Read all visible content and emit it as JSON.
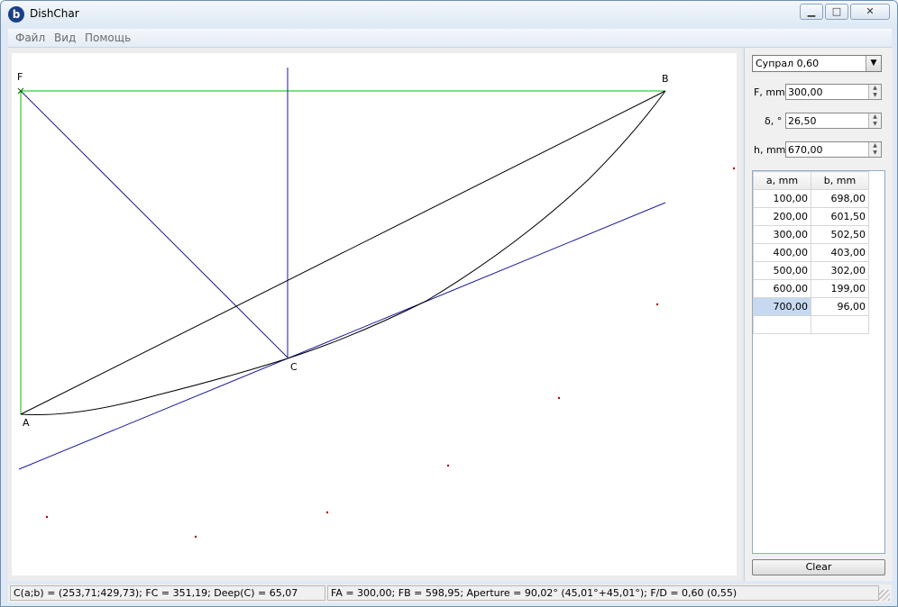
{
  "window": {
    "title": "DishChar",
    "icon": "b"
  },
  "menu": [
    "Файл",
    "Вид",
    "Помощь"
  ],
  "points": {
    "F": "F",
    "B": "B",
    "A": "A",
    "C": "C"
  },
  "controls": {
    "material": "Супрал 0,60",
    "F_label": "F, mm",
    "F_value": "300,00",
    "delta_label": "δ, °",
    "delta_value": "26,50",
    "h_label": "h, mm",
    "h_value": "670,00"
  },
  "table": {
    "headers": [
      "a, mm",
      "b, mm"
    ],
    "rows": [
      [
        "100,00",
        "698,00"
      ],
      [
        "200,00",
        "601,50"
      ],
      [
        "300,00",
        "502,50"
      ],
      [
        "400,00",
        "403,00"
      ],
      [
        "500,00",
        "302,00"
      ],
      [
        "600,00",
        "199,00"
      ],
      [
        "700,00",
        "96,00"
      ]
    ]
  },
  "clear_label": "Clear",
  "status": {
    "left": "C(a;b) = (253,71;429,73); FC = 351,19; Deep(C) = 65,07",
    "right": "FA = 300,00; FB = 598,95; Aperture = 90,02° (45,01°+45,01°); F/D = 0,60 (0,55)"
  },
  "colors": {
    "green": "#00c000",
    "blue": "#1a1a9e",
    "black": "#000000",
    "dot": "#b00000"
  }
}
